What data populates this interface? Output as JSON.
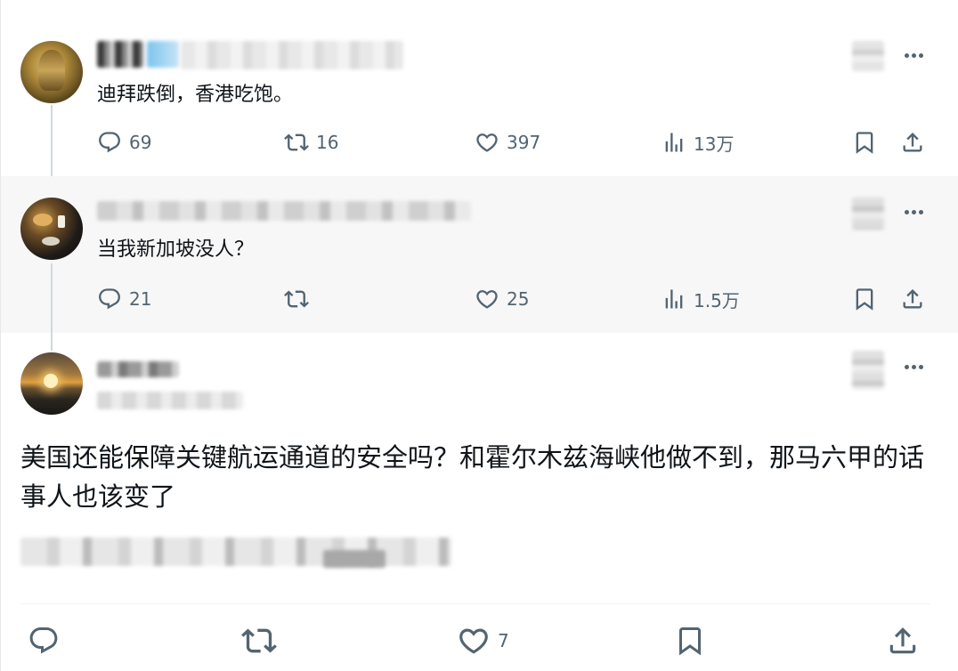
{
  "tweets": [
    {
      "text": "迪拜跌倒，香港吃饱。",
      "reply_count": "69",
      "retweet_count": "16",
      "like_count": "397",
      "view_count": "13万"
    },
    {
      "text": "当我新加坡没人？",
      "reply_count": "21",
      "retweet_count": "",
      "like_count": "25",
      "view_count": "1.5万"
    }
  ],
  "main_tweet": {
    "text": "美国还能保障关键航运通道的安全吗？和霍尔木兹海峡他做不到，那马六甲的话事人也该变了",
    "like_count": "7"
  },
  "colors": {
    "icon_gray": "#536471",
    "text": "#0f1419",
    "highlight_bg": "#f7f7f7",
    "verified_blue": "#1d9bf0"
  },
  "icons": [
    "reply-icon",
    "retweet-icon",
    "like-icon",
    "views-icon",
    "bookmark-icon",
    "share-icon",
    "more-icon"
  ]
}
